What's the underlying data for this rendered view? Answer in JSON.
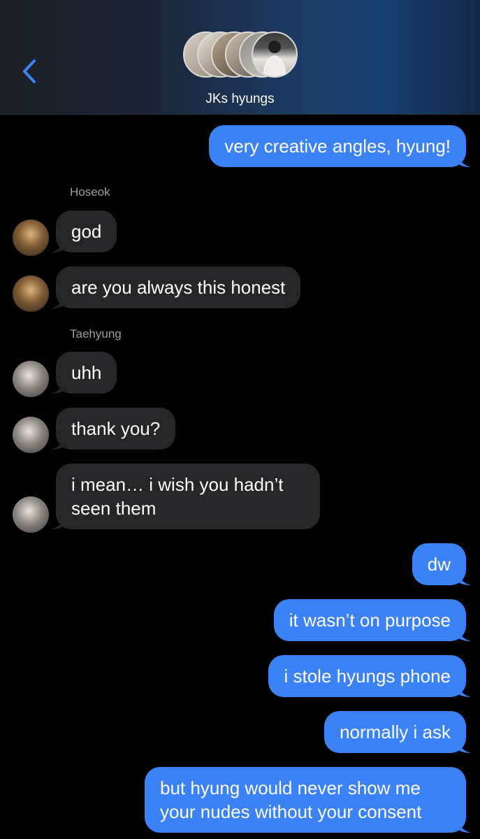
{
  "header": {
    "title": "JKs hyungs",
    "back_icon": "chevron-left-icon",
    "accent": "#3b82f6"
  },
  "messages": [
    {
      "dir": "out",
      "text": "very creative angles, hyung!"
    },
    {
      "sender": "Hoseok"
    },
    {
      "dir": "in",
      "text": "god"
    },
    {
      "dir": "in",
      "text": "are you always this honest"
    },
    {
      "sender": "Taehyung"
    },
    {
      "dir": "in",
      "text": "uhh"
    },
    {
      "dir": "in",
      "text": "thank you?"
    },
    {
      "dir": "in",
      "text": "i mean… i wish you hadn’t seen them"
    },
    {
      "dir": "out",
      "text": "dw"
    },
    {
      "dir": "out",
      "text": "it wasn’t on purpose"
    },
    {
      "dir": "out",
      "text": "i stole hyungs phone"
    },
    {
      "dir": "out",
      "text": "normally i ask"
    },
    {
      "dir": "out",
      "text": "but hyung would never show me your nudes without your consent"
    }
  ],
  "colors": {
    "outgoing_bubble": "#3b82f6",
    "incoming_bubble": "#262628",
    "background": "#000000",
    "sender_name": "#9c9ca1"
  }
}
